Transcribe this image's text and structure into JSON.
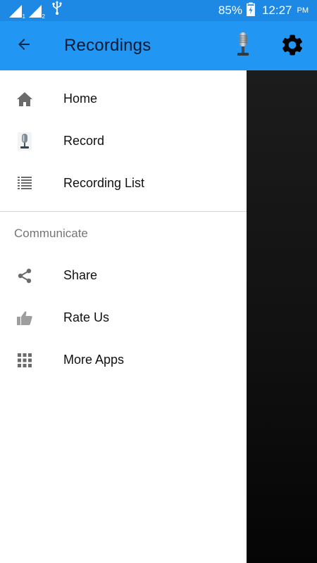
{
  "status_bar": {
    "battery_percent": "85%",
    "time": "12:27",
    "am_pm": "PM",
    "sim1": "1",
    "sim2": "2",
    "icons": [
      "signal-icon",
      "signal-icon",
      "usb-icon",
      "battery-charging-icon"
    ]
  },
  "app_bar": {
    "title": "Recordings",
    "back_icon": "arrow-back-icon",
    "actions": [
      "microphone-icon",
      "settings-gear-icon"
    ],
    "color": "#2196f3"
  },
  "drawer": {
    "main_items": [
      {
        "label": "Home",
        "icon": "home-icon"
      },
      {
        "label": "Record",
        "icon": "microphone-icon"
      },
      {
        "label": "Recording List",
        "icon": "list-icon"
      }
    ],
    "section_title": "Communicate",
    "communicate_items": [
      {
        "label": "Share",
        "icon": "share-icon"
      },
      {
        "label": "Rate Us",
        "icon": "thumbs-up-icon"
      },
      {
        "label": "More Apps",
        "icon": "apps-grid-icon"
      }
    ]
  },
  "colors": {
    "status_bar": "#1e88e5",
    "app_bar": "#2196f3",
    "icon_gray": "#6b6b6b",
    "scrim": "#111111"
  }
}
